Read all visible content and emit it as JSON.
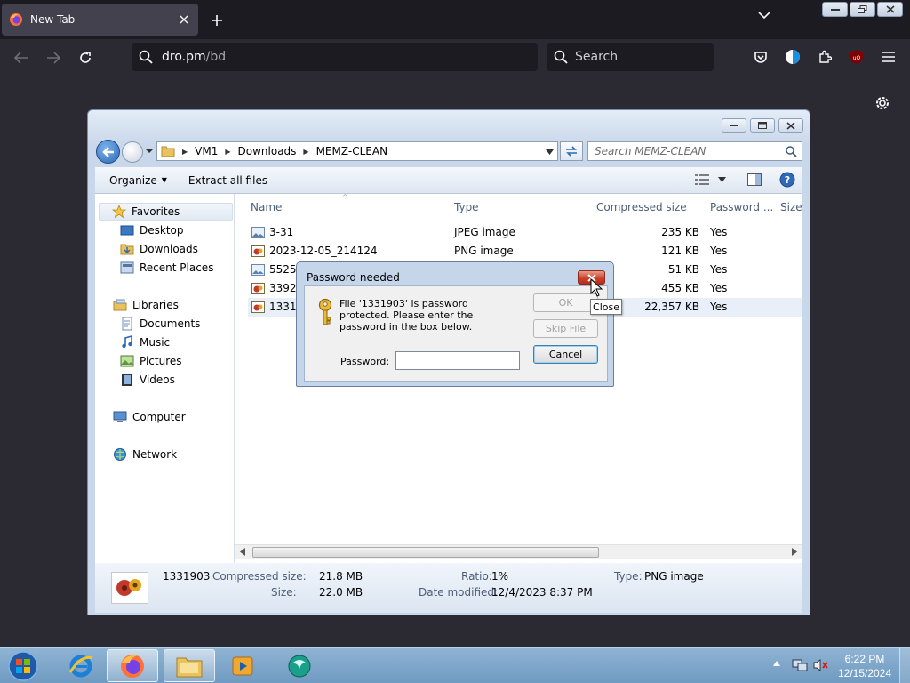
{
  "browser": {
    "tab_title": "New Tab",
    "url_host": "dro.pm",
    "url_path": "/bd",
    "search_placeholder": "Search"
  },
  "explorer": {
    "breadcrumb": [
      "VM1",
      "Downloads",
      "MEMZ-CLEAN"
    ],
    "search_placeholder": "Search MEMZ-CLEAN",
    "toolbar": {
      "organize": "Organize",
      "extract_all": "Extract all files"
    },
    "nav": {
      "favorites": "Favorites",
      "desktop": "Desktop",
      "downloads": "Downloads",
      "recent_places": "Recent Places",
      "libraries": "Libraries",
      "documents": "Documents",
      "music": "Music",
      "pictures": "Pictures",
      "videos": "Videos",
      "computer": "Computer",
      "network": "Network"
    },
    "columns": {
      "name": "Name",
      "type": "Type",
      "compressed_size": "Compressed size",
      "password": "Password ...",
      "size": "Size"
    },
    "files": [
      {
        "name": "3-31",
        "type": "JPEG image",
        "compressed": "235 KB",
        "password": "Yes"
      },
      {
        "name": "2023-12-05_214124",
        "type": "PNG image",
        "compressed": "121 KB",
        "password": "Yes"
      },
      {
        "name": "5525c",
        "type": "",
        "compressed": "51 KB",
        "password": "Yes"
      },
      {
        "name": "33926",
        "type": "",
        "compressed": "455 KB",
        "password": "Yes"
      },
      {
        "name": "13319",
        "type": "",
        "compressed": "22,357 KB",
        "password": "Yes"
      }
    ],
    "details": {
      "name": "1331903",
      "compressed_label": "Compressed size:",
      "compressed_value": "21.8 MB",
      "size_label": "Size:",
      "size_value": "22.0 MB",
      "ratio_label": "Ratio:",
      "ratio_value": "1%",
      "modified_label": "Date modified:",
      "modified_value": "12/4/2023 8:37 PM",
      "type_label": "Type:",
      "type_value": "PNG image"
    }
  },
  "dialog": {
    "title": "Password needed",
    "message": "File '1331903' is password protected. Please enter the password in the box below.",
    "password_label": "Password:",
    "password_value": "",
    "ok": "OK",
    "skip": "Skip File",
    "cancel": "Cancel",
    "close_tooltip": "Close"
  },
  "taskbar": {
    "time": "6:22 PM",
    "date": "12/15/2024"
  }
}
